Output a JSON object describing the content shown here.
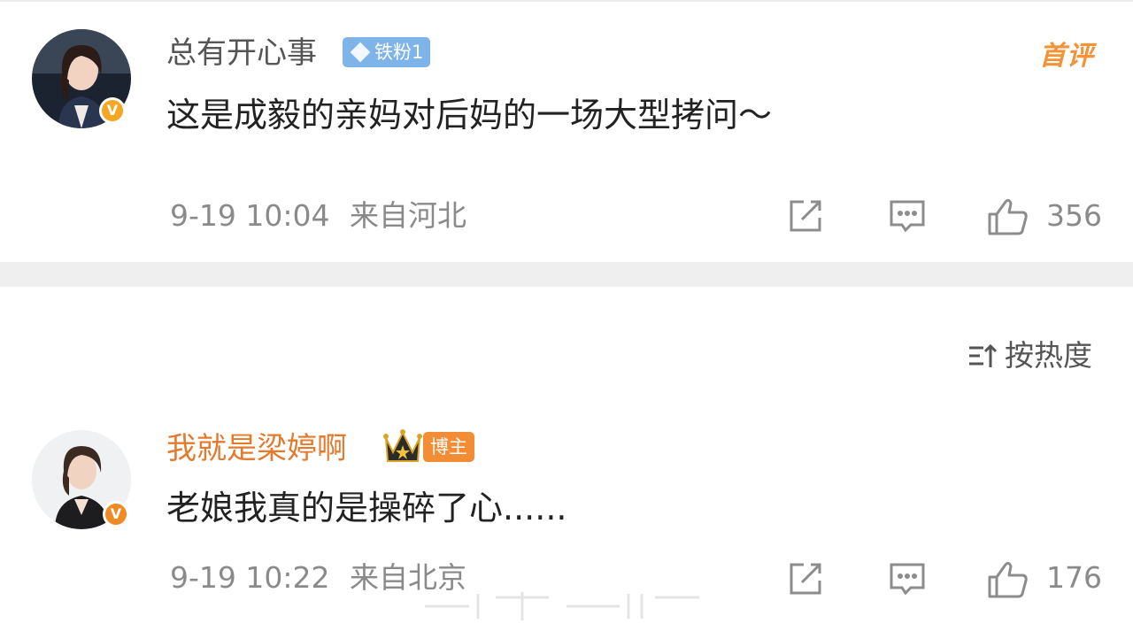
{
  "comments": [
    {
      "username": "总有开心事",
      "badge": "铁粉1",
      "first_comment_label": "首评",
      "text": "这是成毅的亲妈对后妈的一场大型拷问～",
      "date": "9-19 10:04",
      "location": "来自河北",
      "likes": "356"
    },
    {
      "username": "我就是梁婷啊",
      "badge": "博主",
      "text": "老娘我真的是操碎了心......",
      "date": "9-19 10:22",
      "location": "来自北京",
      "likes": "176"
    }
  ],
  "sort": {
    "label": "按热度"
  },
  "icons": {
    "verified": "v-verified-icon",
    "share": "share-icon",
    "comment": "comment-icon",
    "like": "thumbs-up-icon",
    "sort": "sort-icon",
    "crown": "crown-icon",
    "fan": "diamond-icon"
  },
  "colors": {
    "accent_orange": "#f39236",
    "fan_badge": "#7fb4ea",
    "host_badge": "#f28c35",
    "meta_gray": "#8a8a8a"
  }
}
